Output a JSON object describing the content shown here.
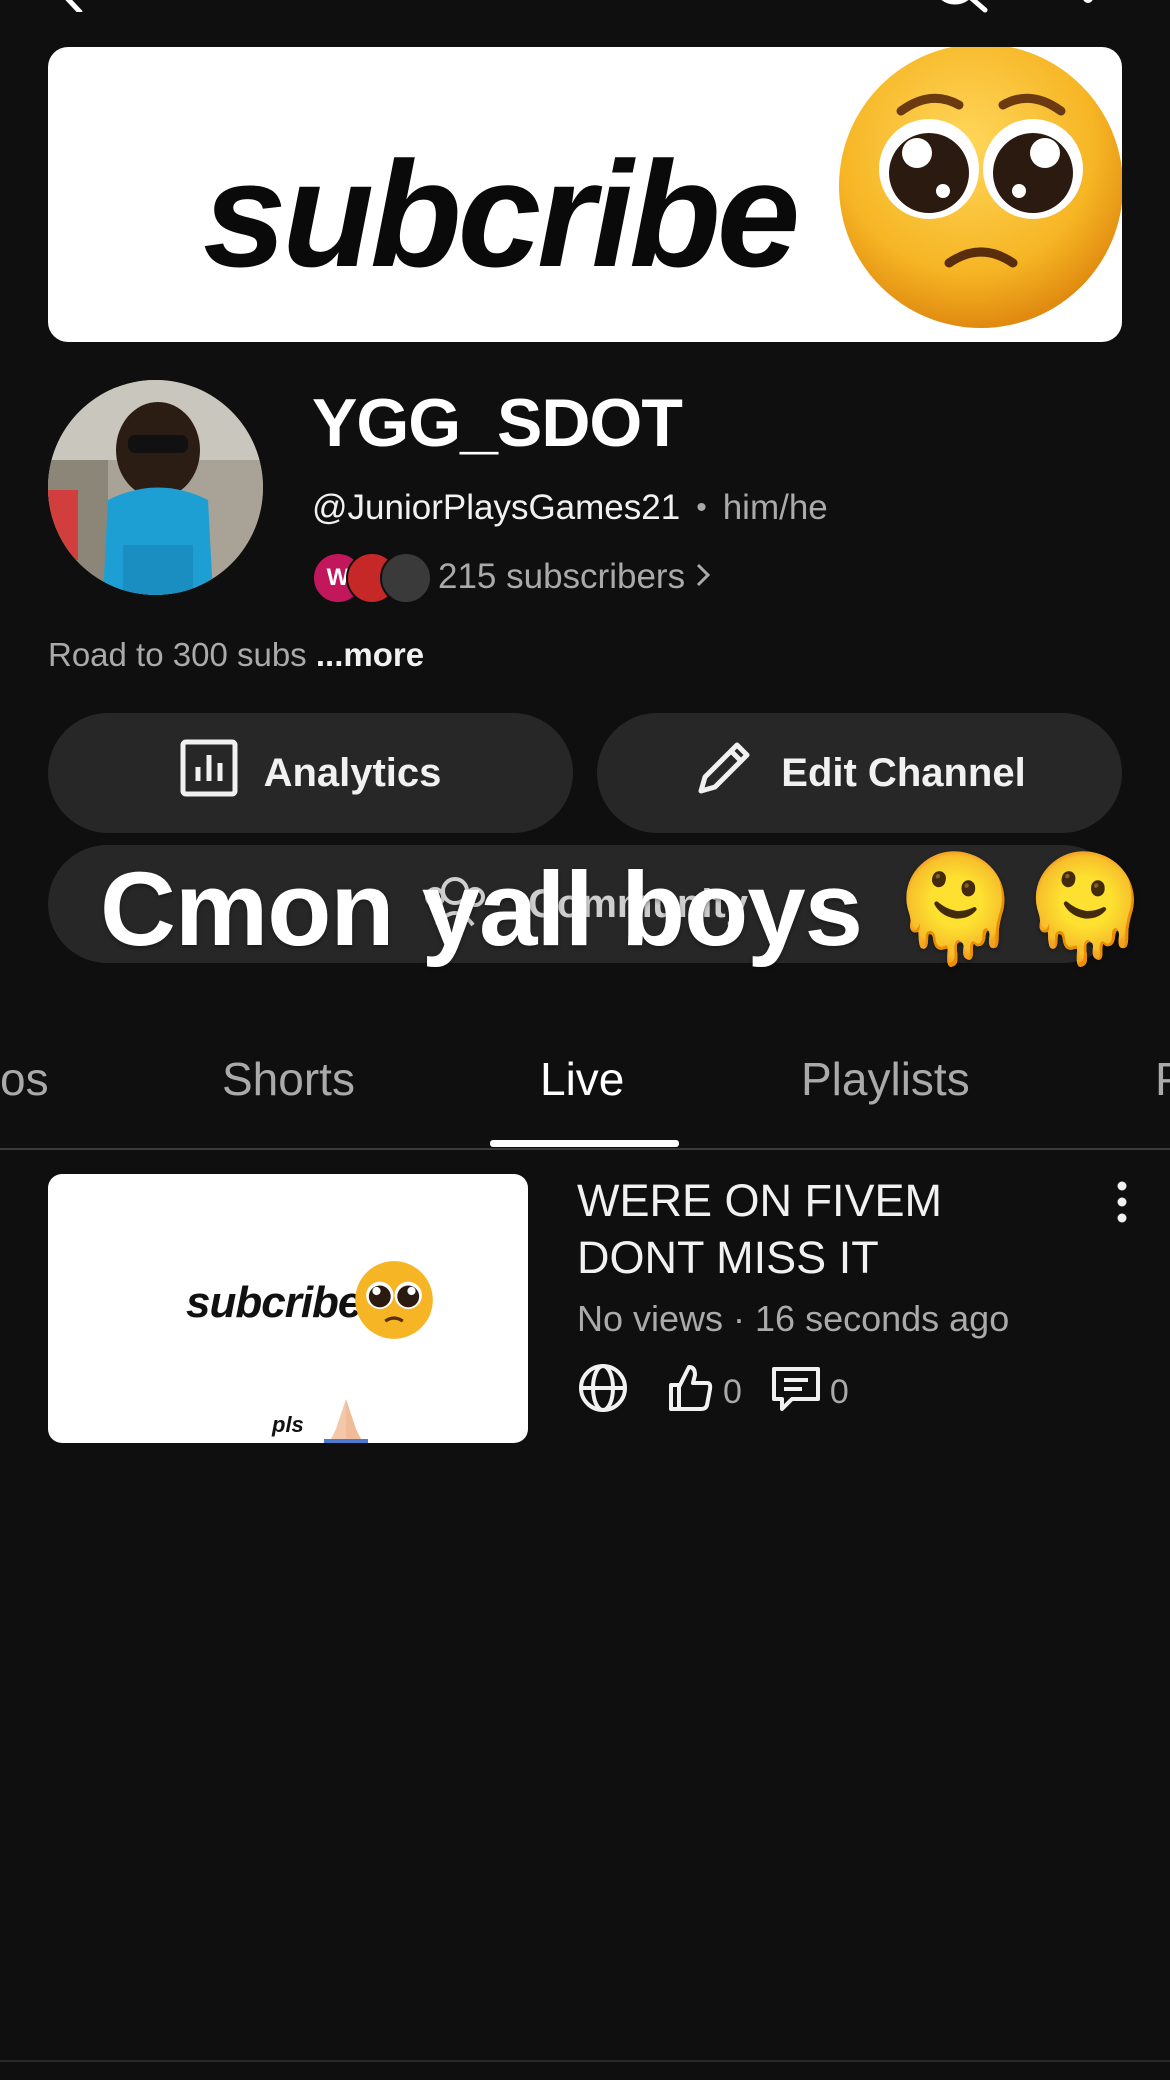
{
  "banner": {
    "text": "subcribe"
  },
  "channel": {
    "name": "YGG_SDOT",
    "handle": "@JuniorPlaysGames21",
    "pronouns": "him/he",
    "subscribers": "215 subscribers",
    "description": "Road to 300 subs",
    "more_label": "...more",
    "sub_avatar_initial": "W"
  },
  "actions": {
    "analytics_label": "Analytics",
    "edit_label": "Edit Channel",
    "community_label": "Community"
  },
  "overlay": {
    "caption": "Cmon yall boys 🫠🫠"
  },
  "tabs": [
    {
      "label": "os"
    },
    {
      "label": "Shorts"
    },
    {
      "label": "Live",
      "active": true
    },
    {
      "label": "Playlists"
    },
    {
      "label": "P"
    }
  ],
  "video": {
    "thumb_text": "subcribe",
    "thumb_small": "pls",
    "title": "WERE ON FIVEM DONT MISS IT",
    "meta": "No views · 16 seconds ago",
    "likes": "0",
    "comments": "0"
  },
  "colors": {
    "background": "#0f0f0f",
    "pill": "#272727",
    "muted": "#aaaaaa"
  }
}
